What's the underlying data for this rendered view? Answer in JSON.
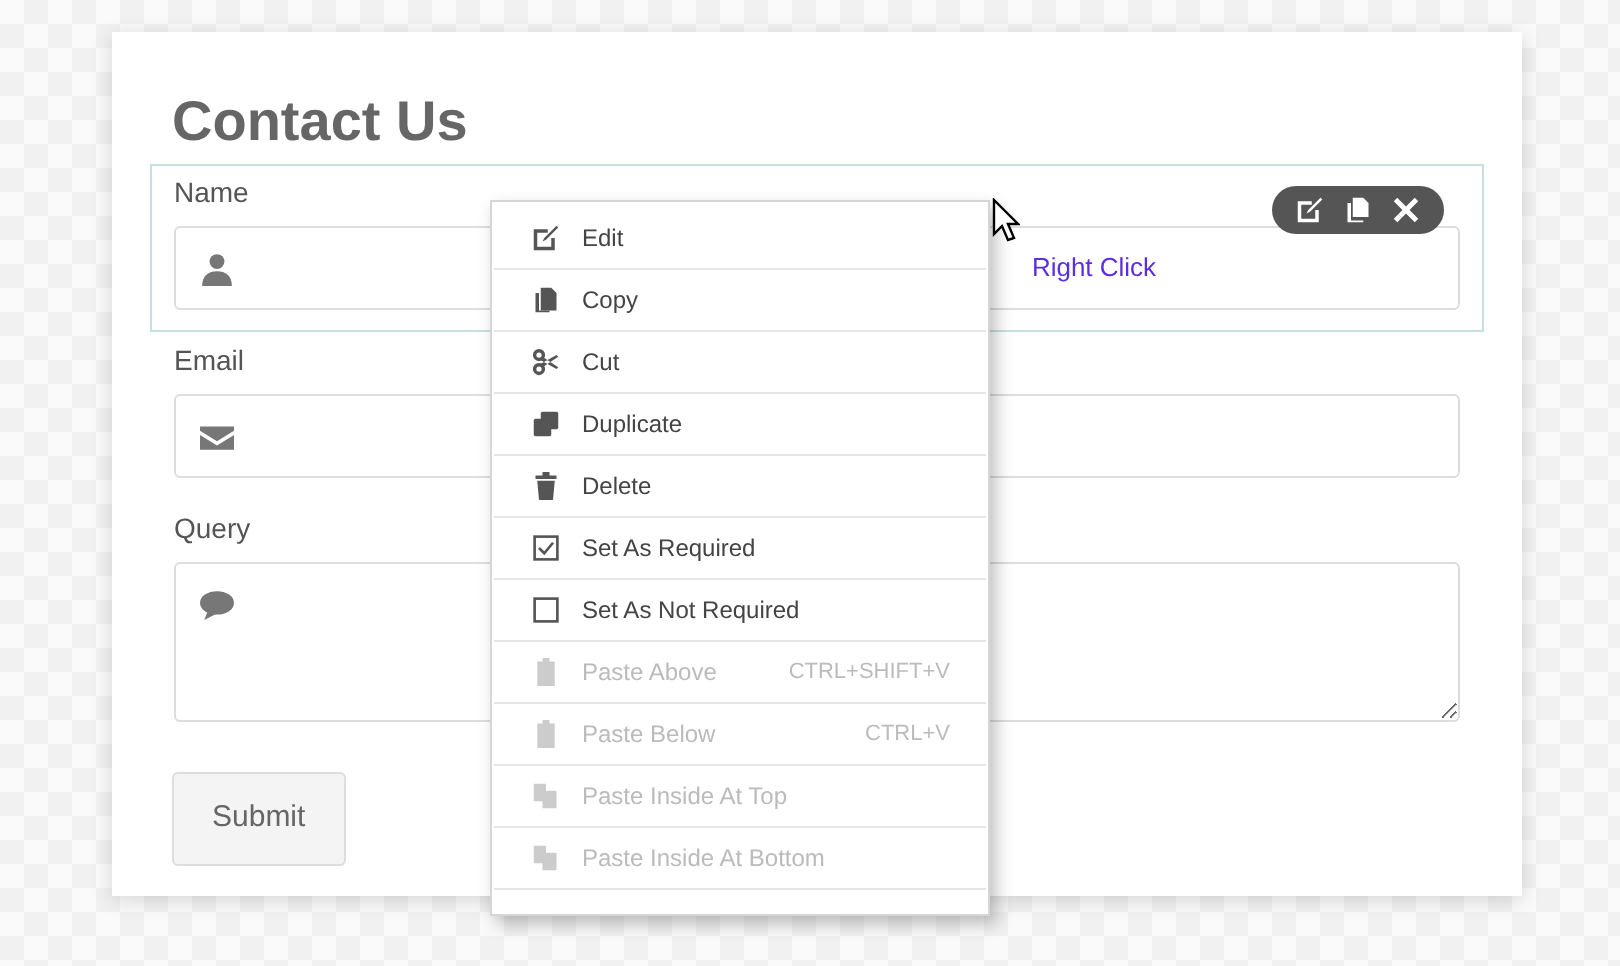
{
  "form": {
    "title": "Contact Us",
    "fields": [
      {
        "kind": "input",
        "label": "Name",
        "selected": true,
        "annotation": "Right Click"
      },
      {
        "kind": "input",
        "label": "Email",
        "selected": false
      },
      {
        "kind": "textarea",
        "label": "Query",
        "selected": false
      }
    ],
    "submit": "Submit"
  },
  "context_menu": {
    "items": [
      {
        "kind": "action",
        "label": "Edit",
        "disabled": false
      },
      {
        "kind": "action",
        "label": "Copy",
        "disabled": false
      },
      {
        "kind": "action",
        "label": "Cut",
        "disabled": false
      },
      {
        "kind": "action",
        "label": "Duplicate",
        "disabled": false
      },
      {
        "kind": "action",
        "label": "Delete",
        "disabled": false
      },
      {
        "kind": "checkbox",
        "label": "Set As Required",
        "checked": true,
        "disabled": false
      },
      {
        "kind": "checkbox",
        "label": "Set As Not Required",
        "checked": false,
        "disabled": false
      },
      {
        "kind": "action",
        "label": "Paste Above",
        "shortcut": "CTRL+SHIFT+V",
        "disabled": true
      },
      {
        "kind": "action",
        "label": "Paste Below",
        "shortcut": "CTRL+V",
        "disabled": true
      },
      {
        "kind": "action",
        "label": "Paste Inside At Top",
        "disabled": true
      },
      {
        "kind": "action",
        "label": "Paste Inside At Bottom",
        "disabled": true
      }
    ]
  }
}
